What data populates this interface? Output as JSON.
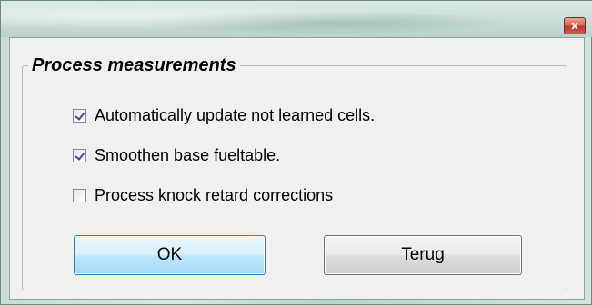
{
  "window": {
    "close_glyph": "x"
  },
  "group": {
    "title": "Process measurements"
  },
  "options": [
    {
      "label": "Automatically update not learned cells.",
      "checked": true
    },
    {
      "label": "Smoothen base fueltable.",
      "checked": true
    },
    {
      "label": "Process knock retard corrections",
      "checked": false
    }
  ],
  "buttons": {
    "ok_label": "OK",
    "back_label": "Terug"
  },
  "colors": {
    "ok_border": "#3c7fb1",
    "close_button": "#c0392b",
    "checkmark": "#3a4d8f"
  }
}
